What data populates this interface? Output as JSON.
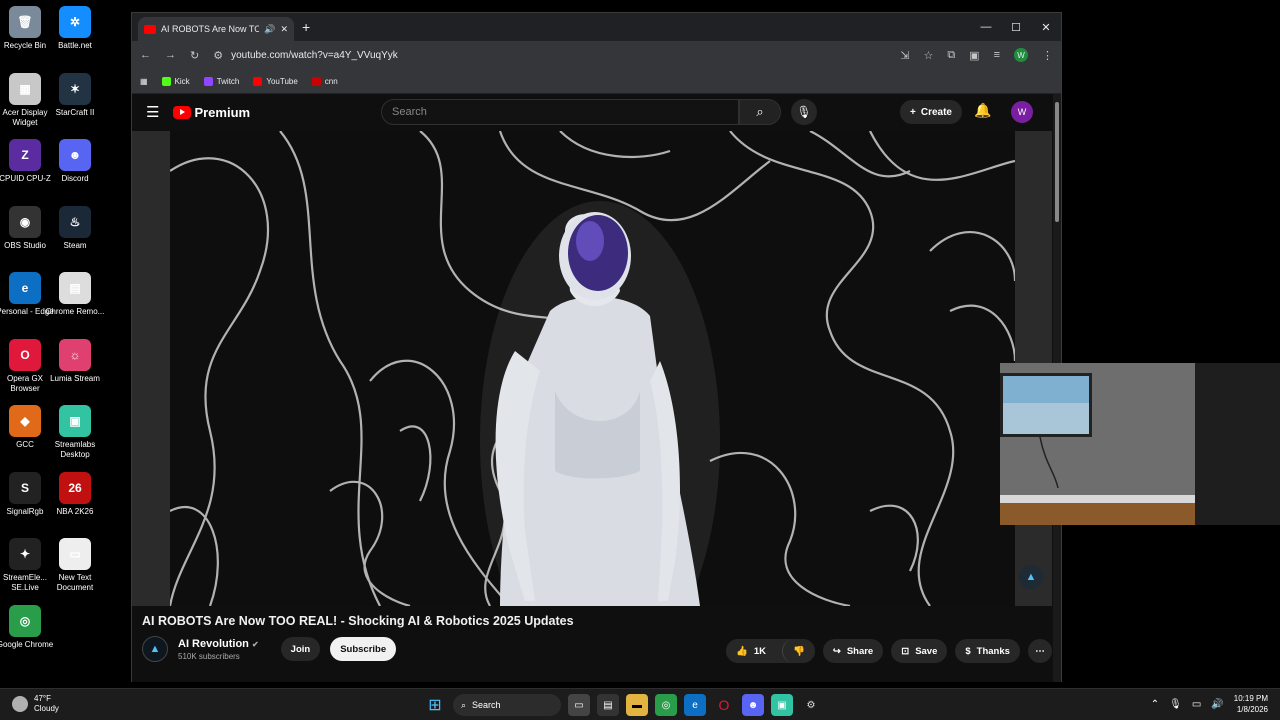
{
  "desktop": {
    "icons": [
      {
        "label": "Recycle Bin",
        "glyph": "🗑",
        "color": "#7a8a9a"
      },
      {
        "label": "Battle.net",
        "glyph": "✲",
        "color": "#148eff"
      },
      {
        "label": "Acer Display Widget",
        "glyph": "▦",
        "color": "#c8c8c8"
      },
      {
        "label": "StarCraft II",
        "glyph": "✶",
        "color": "#223344"
      },
      {
        "label": "CPUID CPU-Z",
        "glyph": "Z",
        "color": "#5a2ca0"
      },
      {
        "label": "Discord",
        "glyph": "☻",
        "color": "#5865f2"
      },
      {
        "label": "OBS Studio",
        "glyph": "◉",
        "color": "#333"
      },
      {
        "label": "Steam",
        "glyph": "♨",
        "color": "#1b2838"
      },
      {
        "label": "Personal - Edge",
        "glyph": "e",
        "color": "#0c6fc4"
      },
      {
        "label": "Chrome Remo...",
        "glyph": "▤",
        "color": "#ddd"
      },
      {
        "label": "Opera GX Browser",
        "glyph": "O",
        "color": "#e0183b"
      },
      {
        "label": "Lumia Stream",
        "glyph": "☼",
        "color": "#e04070"
      },
      {
        "label": "GCC",
        "glyph": "◆",
        "color": "#e06a1a"
      },
      {
        "label": "Streamlabs Desktop",
        "glyph": "▣",
        "color": "#31c3a2"
      },
      {
        "label": "SignalRgb",
        "glyph": "S",
        "color": "#222"
      },
      {
        "label": "NBA 2K26",
        "glyph": "26",
        "color": "#c01010"
      },
      {
        "label": "StreamEle... SE.Live",
        "glyph": "✦",
        "color": "#222"
      },
      {
        "label": "New Text Document",
        "glyph": "▭",
        "color": "#eee"
      },
      {
        "label": "Google Chrome",
        "glyph": "◎",
        "color": "#2a9d4a"
      }
    ]
  },
  "browser": {
    "tab_title": "AI ROBOTS Are Now TOO R",
    "new_tab": "+",
    "controls": {
      "minimize": "—",
      "maximize": "☐",
      "close": "✕"
    },
    "url": "youtube.com/watch?v=a4Y_VVuqYyk",
    "profile_letter": "W",
    "bookmarks": [
      {
        "label": "Kick",
        "color": "#53fc18"
      },
      {
        "label": "Twitch",
        "color": "#9146ff"
      },
      {
        "label": "YouTube",
        "color": "#ff0000"
      },
      {
        "label": "cnn",
        "color": "#cc0000"
      }
    ]
  },
  "youtube": {
    "logo_text": "Premium",
    "search_placeholder": "Search",
    "create_label": "Create",
    "avatar_letter": "W",
    "video_title": "AI ROBOTS Are Now TOO REAL! - Shocking AI & Robotics 2025 Updates",
    "channel_name": "AI Revolution",
    "subscribers": "510K subscribers",
    "join_label": "Join",
    "subscribe_label": "Subscribe",
    "likes": "1K",
    "share_label": "Share",
    "save_label": "Save",
    "thanks_label": "Thanks",
    "more": "⋯"
  },
  "taskbar": {
    "temp": "47°F",
    "condition": "Cloudy",
    "search_label": "Search",
    "time": "10:19 PM",
    "date": "1/8/2026"
  }
}
